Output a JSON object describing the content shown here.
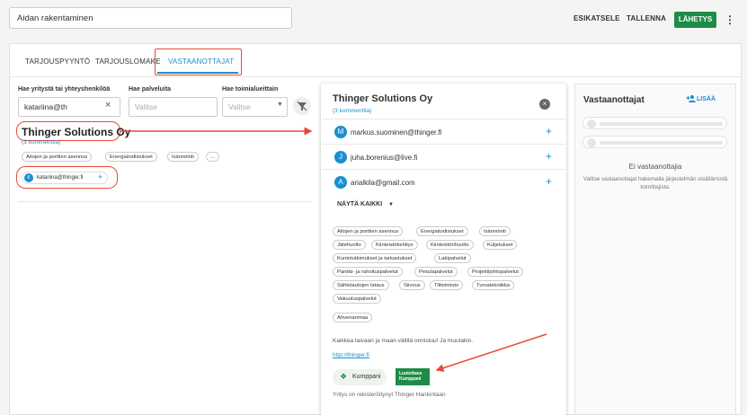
{
  "topbar": {
    "title_value": "Aidan rakentaminen",
    "preview_label": "ESIKATSELE",
    "save_label": "TALLENNA",
    "send_label": "LÄHETYS",
    "more_label": "⋮"
  },
  "tabs": [
    "TARJOUSPYYNTÖ",
    "TARJOUSLOMAKE",
    "VASTAANOTTAJAT"
  ],
  "filters": {
    "search_label": "Hae yritystä tai yhteyshenkilöä",
    "search_value": "katariina@th",
    "services_label": "Hae palveluita",
    "services_placeholder": "Valitse",
    "area_label": "Hae toimialueittain",
    "area_placeholder": "Valitse"
  },
  "result": {
    "company": "Thinger Solutions Oy",
    "comments": "(3 kommenttia)",
    "chips": [
      "Aitojen ja porttien asennus",
      "Energiatodistukset",
      "Isännöinti",
      "..."
    ],
    "contact_initial": "K",
    "contact_email": "katariina@thinger.fi",
    "contact_plus": "+"
  },
  "panel": {
    "title": "Thinger Solutions Oy",
    "comments": "(3 kommenttia)",
    "close_glyph": "×",
    "contacts": [
      {
        "initial": "M",
        "email": "markus.suominen@thinger.fi"
      },
      {
        "initial": "J",
        "email": "juha.borenius@live.fi"
      },
      {
        "initial": "A",
        "email": "arialkila@gmail.com"
      }
    ],
    "plus_glyph": "+",
    "show_all": "NÄYTÄ KAIKKI",
    "tags": [
      "Aitojen ja porttien asennus",
      "Energiatodistukset",
      "Isännöinti",
      "Jätehuolto",
      "Kiinteistökehitys",
      "Kiinteistönhuolto",
      "Kuljetukset",
      "Kuntotutkimukset ja tarkastukset",
      "Lakipalvelut",
      "Pankki- ja rahoituspalvelut",
      "Pesulapalvelut",
      "Projektijohtopalvelut",
      "Sähköautojen lataus",
      "Siivous",
      "Tilitoimisto",
      "Turvatekniikka",
      "Vakuutuspalvelut"
    ],
    "region_tag": "Ahvenanmaa",
    "description": "Kaikkea taivaan ja maan väliltä onnistuu! Ja muutakin.",
    "link": "http://thinger.fi",
    "partner_label": "Kumppani",
    "trust_badge_line1": "Luotettava",
    "trust_badge_line2": "Kumppani",
    "footer_note": "Yritys on rekisteröitynyt Thinger Hankintaan"
  },
  "recipients": {
    "title": "Vastaanottajat",
    "add_label": "LISÄÄ",
    "empty_title": "Ei vastaanottajia",
    "empty_sub": "Valitse vastaanottajat hakemalla järjestelmän sisältämistä toimittajista."
  },
  "colors": {
    "accent": "#1b8fd0",
    "send": "#1e8c46",
    "annotation": "#e84a34"
  }
}
